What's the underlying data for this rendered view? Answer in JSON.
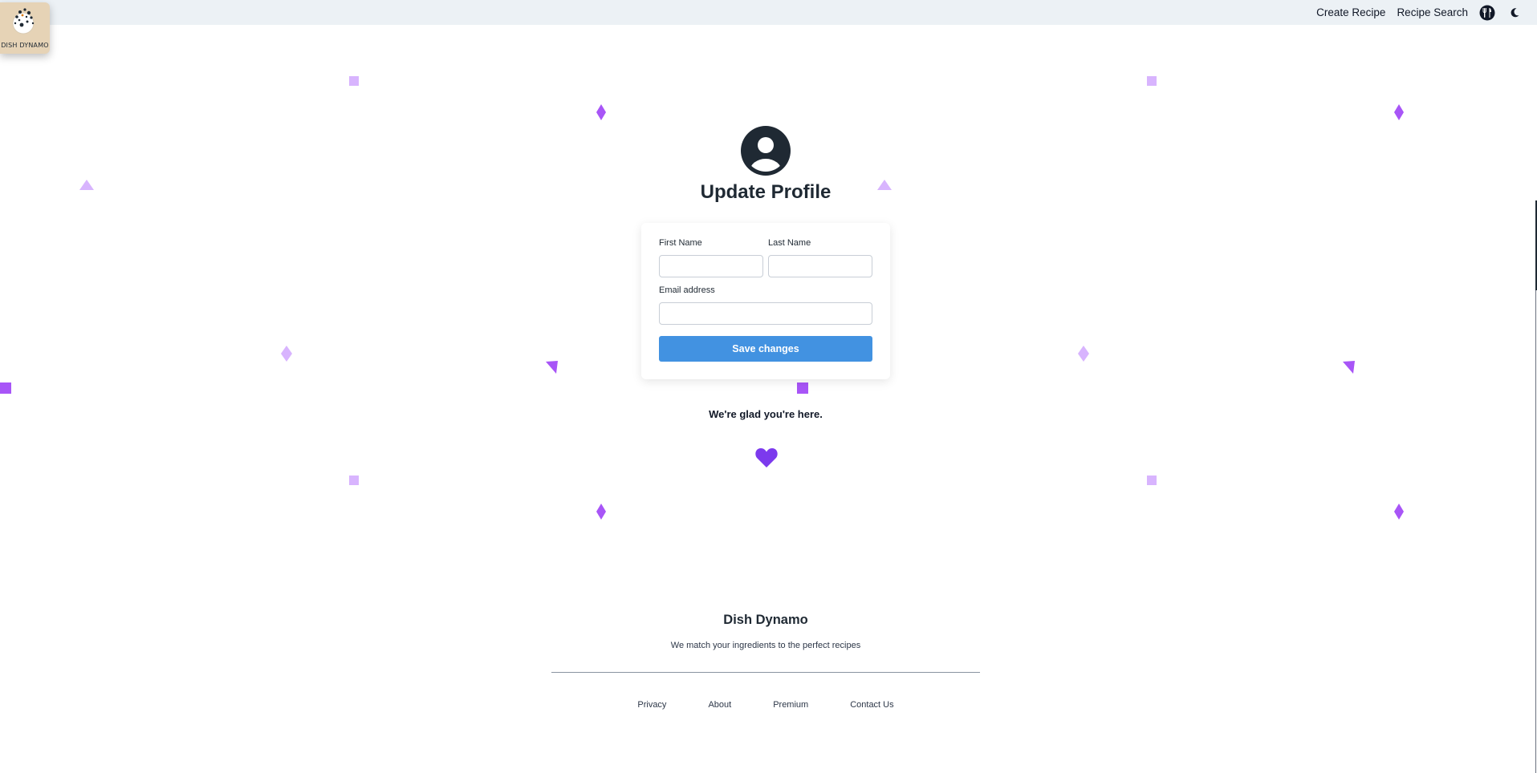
{
  "logo": {
    "text": "DISH DYNAMO",
    "icon": "dish-dynamo-logo"
  },
  "nav": {
    "links": [
      "Create Recipe",
      "Recipe Search"
    ],
    "icons": [
      "utensils-icon",
      "moon-icon"
    ]
  },
  "profile": {
    "icon": "user-circle-icon",
    "title": "Update Profile",
    "first_name": {
      "label": "First Name",
      "value": ""
    },
    "last_name": {
      "label": "Last Name",
      "value": ""
    },
    "email": {
      "label": "Email address",
      "value": ""
    },
    "save_label": "Save changes"
  },
  "message": "We're glad you're here.",
  "heart_icon": "heart-icon",
  "footer": {
    "title": "Dish Dynamo",
    "tagline": "We match your ingredients to the perfect recipes",
    "links": [
      "Privacy",
      "About",
      "Premium",
      "Contact Us"
    ]
  },
  "colors": {
    "accent": "#4292e1",
    "confetti_dark": "#a855f7",
    "confetti_light": "#d8b4fe",
    "heart": "#7c3aed",
    "topbar": "#ecf1f5"
  }
}
